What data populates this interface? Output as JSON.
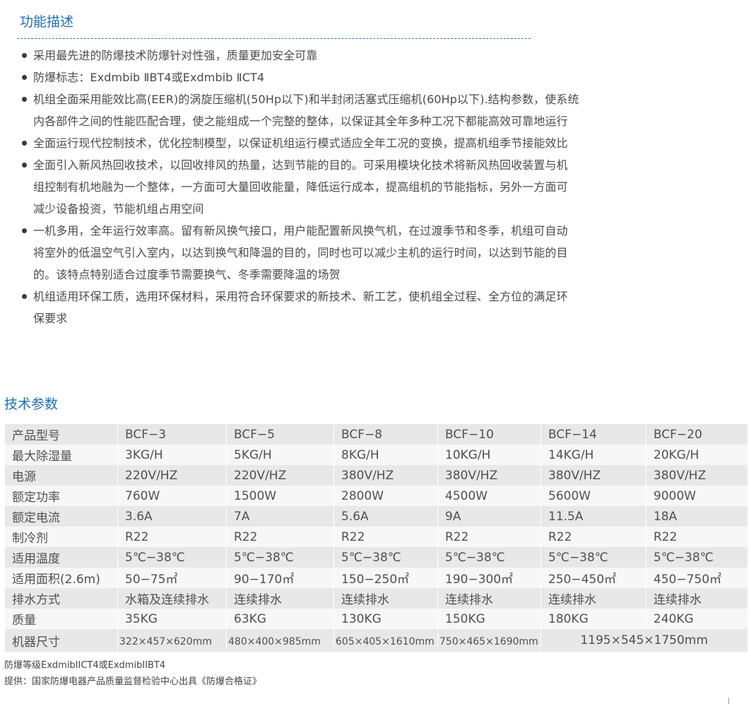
{
  "features": {
    "title": "功能描述",
    "items": [
      {
        "lines": [
          "采用最先进的防爆技术防爆针对性强，质量更加安全可靠"
        ]
      },
      {
        "lines": [
          "防爆标志：Exdmbib ⅡBT4或Exdmbib ⅡCT4"
        ]
      },
      {
        "lines": [
          "机组全面采用能效比高(EER)的涡旋压缩机(50Hp以下)和半封闭活塞式压缩机(60Hp以下).结构参数，使系统",
          "内各部件之间的性能匹配合理，使之能组成一个完整的整体，以保证其全年多种工况下都能高效可靠地运行"
        ]
      },
      {
        "lines": [
          "全面运行现代控制技术，优化控制模型，以保证机组运行模式适应全年工况的变换，提高机组季节接能效比"
        ]
      },
      {
        "lines": [
          "全面引入新风热回收技术，以回收排风的热量，达到节能的目的。可采用模块化技术将新风热回收装置与机",
          "组控制有机地融为一个整体，一方面可大量回收能量，降低运行成本，提高组机的节能指标，另外一方面可",
          "减少设备投资，节能机组占用空间"
        ]
      },
      {
        "lines": [
          "一机多用，全年运行效率高。留有新风换气接口，用户能配置新风换气机，在过渡季节和冬季，机组可自动",
          "将室外的低温空气引入室内，以达到换气和降温的目的，同时也可以减少主机的运行时间，以达到节能的目",
          "的。该特点特别适合过度季节需要换气、冬季需要降温的场贺"
        ]
      },
      {
        "lines": [
          "机组适用环保工质，选用环保材料，采用符合环保要求的新技术、新工艺，使机组全过程、全方位的满足环",
          "保要求"
        ]
      }
    ]
  },
  "specs": {
    "title": "技术参数",
    "rows": [
      {
        "label": "产品型号",
        "values": [
          "BCF−3",
          "BCF−5",
          "BCF−8",
          "BCF−10",
          "BCF−14",
          "BCF−20"
        ]
      },
      {
        "label": "最大除湿量",
        "values": [
          "3KG/H",
          "5KG/H",
          "8KG/H",
          "10KG/H",
          "14KG/H",
          "20KG/H"
        ]
      },
      {
        "label": "电源",
        "values": [
          "220V/HZ",
          "220V/HZ",
          "380V/HZ",
          "380V/HZ",
          "380V/HZ",
          "380V/HZ"
        ]
      },
      {
        "label": "额定功率",
        "values": [
          "760W",
          "1500W",
          "2800W",
          "4500W",
          "5600W",
          "9000W"
        ]
      },
      {
        "label": "额定电流",
        "values": [
          "3.6A",
          "7A",
          "5.6A",
          "9A",
          "11.5A",
          "18A"
        ]
      },
      {
        "label": "制冷剂",
        "values": [
          "R22",
          "R22",
          "R22",
          "R22",
          "R22",
          "R22"
        ]
      },
      {
        "label": "适用温度",
        "values": [
          "5℃−38℃",
          "5℃−38℃",
          "5℃−38℃",
          "5℃−38℃",
          "5℃−38℃",
          "5℃−38℃"
        ]
      },
      {
        "label": "适用面积(2.6m)",
        "values": [
          "50−75㎡",
          "90−170㎡",
          "150−250㎡",
          "190−300㎡",
          "250−450㎡",
          "450−750㎡"
        ]
      },
      {
        "label": "排水方式",
        "values": [
          "水箱及连续排水",
          "连续排水",
          "连续排水",
          "连续排水",
          "连续排水",
          "连续排水"
        ]
      },
      {
        "label": "质量",
        "values": [
          "35KG",
          "63KG",
          "130KG",
          "150KG",
          "180KG",
          "240KG"
        ]
      }
    ],
    "size_row": {
      "label": "机器尺寸",
      "values": [
        "322×457×620mm",
        "480×400×985mm",
        "605×405×1610mm",
        "750×465×1690mm"
      ],
      "merged_value": "1195×545×1750mm"
    }
  },
  "notes": {
    "line1": "防爆等级ExdmibIICT4或ExdmibIIBT4",
    "line2": "提供：国家防爆电器产品质量监督检验中心出具《防爆合格证》"
  }
}
